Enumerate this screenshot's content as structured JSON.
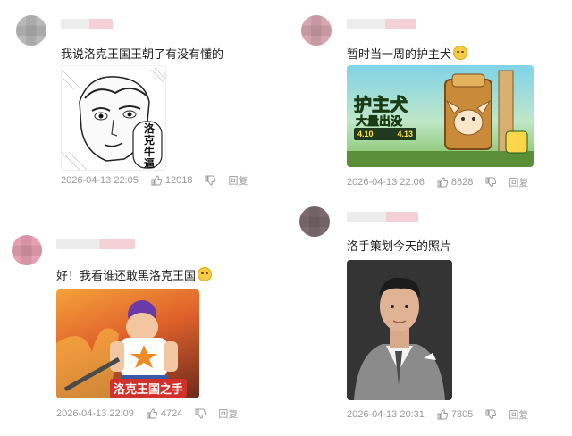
{
  "comments": [
    {
      "text": "我说洛克王国王朝了有没有懂的",
      "image_caption": "洛克牛逼",
      "date": "2026-04-13 22:05",
      "likes": "12018",
      "reply_label": "回复",
      "avatar_color": "#b9b9b9"
    },
    {
      "text": "暂时当一周的护主犬",
      "image_title": "护主犬",
      "image_subtitle": "大量出没",
      "image_date1": "4.10",
      "image_date2": "4.13",
      "date": "2026-04-13 22:06",
      "likes": "8628",
      "reply_label": "回复",
      "avatar_color": "#d7a6b0"
    },
    {
      "text": "好！我看谁还敢黑洛克王国",
      "image_caption": "洛克王国之手",
      "date": "2026-04-13 22:09",
      "likes": "4724",
      "reply_label": "回复",
      "avatar_color": "#e6a0b2"
    },
    {
      "text": "洛手策划今天的照片",
      "date": "2026-04-13 20:31",
      "likes": "7805",
      "reply_label": "回复",
      "avatar_color": "#7d6a6f"
    }
  ],
  "colors": {
    "meta": "#9a9a9a",
    "text": "#222222",
    "accent": "#f3c7cf"
  }
}
